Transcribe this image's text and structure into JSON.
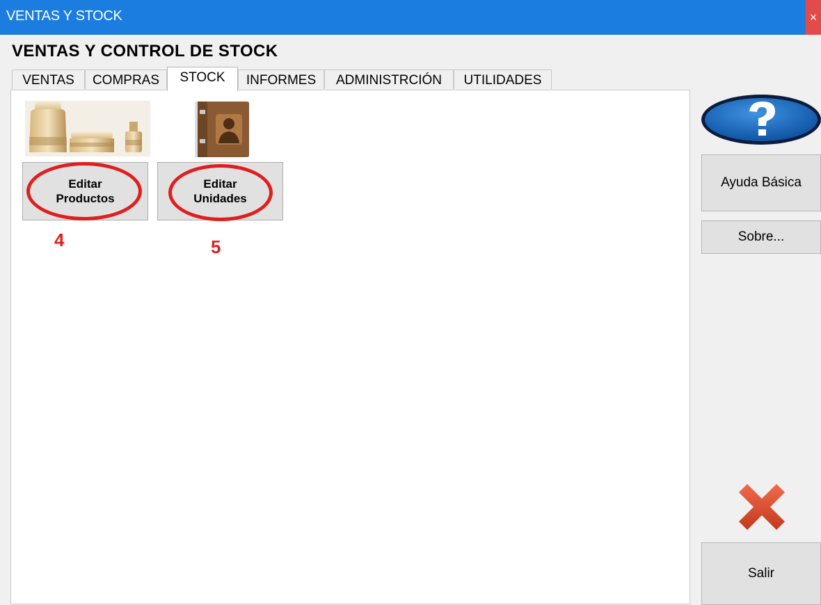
{
  "window": {
    "title": "VENTAS Y STOCK",
    "close_glyph": "×"
  },
  "app": {
    "heading": "VENTAS Y CONTROL DE STOCK"
  },
  "tabs": [
    {
      "label": "VENTAS"
    },
    {
      "label": "COMPRAS"
    },
    {
      "label": "STOCK",
      "active": true
    },
    {
      "label": "INFORMES"
    },
    {
      "label": "ADMINISTRCIÓN"
    },
    {
      "label": "UTILIDADES"
    }
  ],
  "stock_panel": {
    "edit_products": {
      "line1": "Editar",
      "line2": "Productos",
      "icon": "products-image",
      "annotation": "4"
    },
    "edit_units": {
      "line1": "Editar",
      "line2": "Unidades",
      "icon": "address-book-icon",
      "annotation": "5"
    }
  },
  "sidebar": {
    "help_icon": "question-mark-icon",
    "help_button": "Ayuda Básica",
    "about_button": "Sobre...",
    "exit_icon": "red-x-icon",
    "exit_button": "Salir"
  },
  "colors": {
    "titlebar": "#1a7ddf",
    "annotation": "#e01e1e"
  }
}
